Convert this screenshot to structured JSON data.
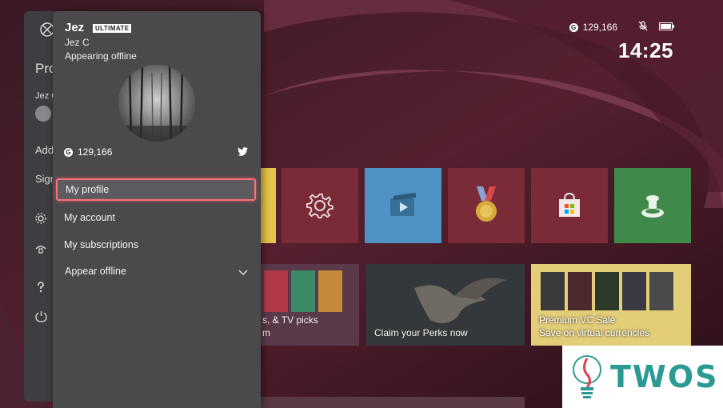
{
  "status": {
    "gamerscore": "129,166",
    "time": "14:25"
  },
  "guide": {
    "partial_items": [
      "Pro",
      "Jez C",
      "Add",
      "Sign"
    ]
  },
  "profile": {
    "gamertag": "Jez",
    "badge": "ULTIMATE",
    "real_name": "Jez C",
    "presence": "Appearing offline",
    "gamerscore": "129,166"
  },
  "menu": {
    "items": [
      {
        "label": "My profile",
        "selected": true
      },
      {
        "label": "My account"
      },
      {
        "label": "My subscriptions"
      },
      {
        "label": "Appear offline",
        "has_dropdown": true
      }
    ]
  },
  "tiles": {
    "promo": [
      {
        "caption": "s, & TV picks\nm"
      },
      {
        "caption": "Claim your Perks now"
      },
      {
        "caption": "Premium VC Sale\nSave on virtual currencies"
      }
    ]
  },
  "watermark": {
    "text": "TWOS"
  },
  "colors": {
    "accent": "#ff6f7a",
    "panel": "#4a4a4d",
    "settings_tile": "#7b2a37",
    "blue_tile": "#4f93c6",
    "green_tile": "#3f8a4a"
  },
  "icons": [
    "xbox-icon",
    "mic-muted-icon",
    "battery-icon",
    "twitter-icon",
    "gear-icon",
    "movies-icon",
    "achievement-medal-icon",
    "store-icon",
    "gamepass-icon",
    "help-icon",
    "power-icon",
    "chevron-down-icon"
  ]
}
